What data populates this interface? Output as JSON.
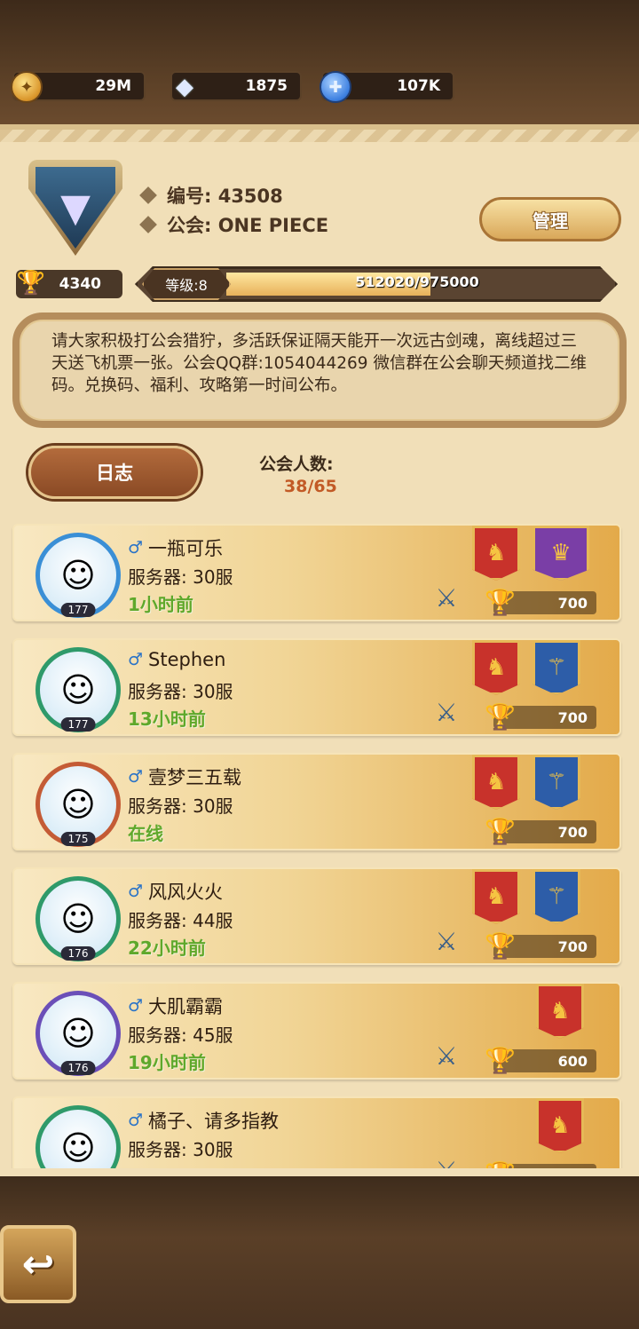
{
  "resources": [
    {
      "icon": "gold-coin-icon",
      "value": "29M"
    },
    {
      "icon": "diamond-icon",
      "value": "1875"
    },
    {
      "icon": "blue-crystal-icon",
      "value": "107K"
    }
  ],
  "guild": {
    "id_label": "编号: 43508",
    "name_label": "公会: ONE PIECE",
    "manage_label": "管理",
    "trophies": "4340",
    "level_label": "等级:8",
    "exp_text": "512020/975000",
    "exp_fraction": 0.525,
    "notice": "请大家积极打公会猎狞，多活跃保证隔天能开一次远古剑魂，离线超过三天送飞机票一张。公会QQ群:1054044269 微信群在公会聊天频道找二维码。兑换码、福利、攻略第一时间公布。"
  },
  "log_label": "日志",
  "member_label": "公会人数:",
  "member_count": "38/65",
  "members": [
    {
      "name": "一瓶可乐",
      "server": "服务器: 30服",
      "time": "1小时前",
      "level": "177",
      "score": "700",
      "banners": [
        "red",
        "purple"
      ],
      "swords": true,
      "avatar_color": "#3a8fd6"
    },
    {
      "name": "Stephen",
      "server": "服务器: 30服",
      "time": "13小时前",
      "level": "177",
      "score": "700",
      "banners": [
        "red",
        "blue"
      ],
      "swords": true,
      "avatar_color": "#2f9a6a"
    },
    {
      "name": "壹梦三五载",
      "server": "服务器: 30服",
      "time": "在线",
      "level": "175",
      "score": "700",
      "banners": [
        "red",
        "blue"
      ],
      "swords": false,
      "avatar_color": "#c45b35"
    },
    {
      "name": "风风火火",
      "server": "服务器: 44服",
      "time": "22小时前",
      "level": "176",
      "score": "700",
      "banners": [
        "red",
        "blue"
      ],
      "swords": true,
      "avatar_color": "#2f9a6a"
    },
    {
      "name": "大肌霸霸",
      "server": "服务器: 45服",
      "time": "19小时前",
      "level": "176",
      "score": "600",
      "banners": [
        "red"
      ],
      "swords": true,
      "avatar_color": "#6b4fb8"
    },
    {
      "name": "橘子、请多指教",
      "server": "服务器: 30服",
      "time": "",
      "level": "",
      "score": "",
      "banners": [
        "red"
      ],
      "swords": true,
      "avatar_color": "#2f9a6a"
    }
  ],
  "male_symbol": "♂"
}
